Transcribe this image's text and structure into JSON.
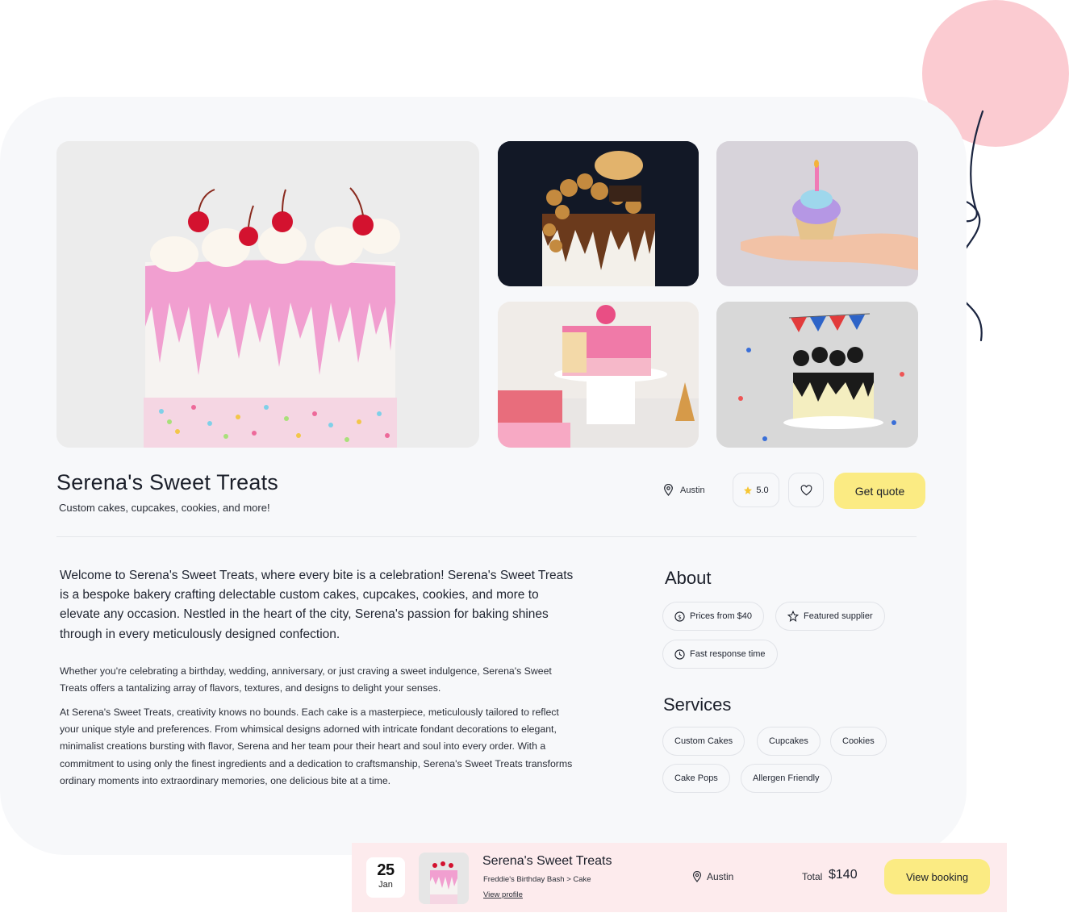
{
  "supplier": {
    "name": "Serena's Sweet Treats",
    "tagline": "Custom cakes, cupcakes, cookies, and more!",
    "location": "Austin",
    "rating": "5.0",
    "quote_label": "Get quote"
  },
  "description": {
    "intro": "Welcome to Serena's Sweet Treats, where every bite is a celebration! Serena's Sweet Treats is a bespoke bakery crafting delectable custom cakes, cupcakes, cookies, and more to elevate any occasion. Nestled in the heart of the city, Serena's passion for baking shines through in every meticulously designed confection.",
    "p2": "Whether you're celebrating a birthday, wedding, anniversary, or just craving a sweet indulgence, Serena's Sweet Treats offers a tantalizing array of flavors, textures, and designs to delight your senses.",
    "p3": "At Serena's Sweet Treats, creativity knows no bounds. Each cake is a masterpiece, meticulously tailored to reflect your unique style and preferences. From whimsical designs adorned with intricate fondant decorations to elegant, minimalist creations bursting with flavor, Serena and her team pour their heart and soul into every order. With a commitment to using only the finest ingredients and a dedication to craftsmanship, Serena's Sweet Treats transforms ordinary moments into extraordinary memories, one delicious bite at a time."
  },
  "about": {
    "heading": "About",
    "items": [
      "Prices from $40",
      "Featured supplier",
      "Fast response time"
    ]
  },
  "services": {
    "heading": "Services",
    "items": [
      "Custom Cakes",
      "Cupcakes",
      "Cookies",
      "Cake Pops",
      "Allergen Friendly"
    ]
  },
  "booking": {
    "day": "25",
    "month": "Jan",
    "title": "Serena's Sweet Treats",
    "breadcrumb": "Freddie's Birthday Bash > Cake",
    "profile_link": "View profile",
    "location": "Austin",
    "total_label": "Total",
    "total_value": "$140",
    "button_label": "View booking"
  },
  "icons": {
    "location": "map-pin-icon",
    "rating": "star-icon",
    "favorite": "heart-icon",
    "price": "dollar-circle-icon",
    "featured": "star-outline-icon",
    "response": "clock-icon"
  },
  "colors": {
    "accent": "#fbeb83",
    "balloon": "#fbcbd1",
    "card_bg": "#f7f8fa",
    "booking_bg": "#fdebed"
  }
}
